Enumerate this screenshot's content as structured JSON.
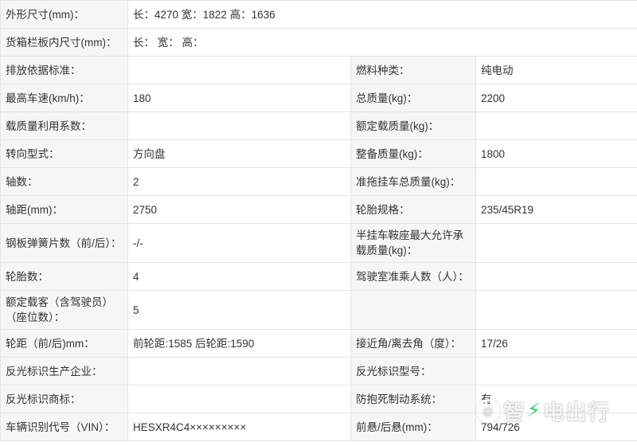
{
  "rows": [
    {
      "type": "wide",
      "label": "外形尺寸(mm)：",
      "value": "长：4270 宽：1822 高：1636"
    },
    {
      "type": "wide",
      "label": "货箱栏板内尺寸(mm)：",
      "value": "长： 宽： 高："
    },
    {
      "type": "pair",
      "label1": "排放依据标准：",
      "value1": "",
      "label2": "燃料种类：",
      "value2": "纯电动"
    },
    {
      "type": "pair",
      "label1": "最高车速(km/h)：",
      "value1": "180",
      "label2": "总质量(kg)：",
      "value2": "2200"
    },
    {
      "type": "pair",
      "label1": "载质量利用系数：",
      "value1": "",
      "label2": "额定载质量(kg)：",
      "value2": ""
    },
    {
      "type": "pair",
      "label1": "转向型式：",
      "value1": "方向盘",
      "label2": "整备质量(kg)：",
      "value2": "1800"
    },
    {
      "type": "pair",
      "label1": "轴数：",
      "value1": "2",
      "label2": "准拖挂车总质量(kg)：",
      "value2": ""
    },
    {
      "type": "pair",
      "label1": "轴距(mm)：",
      "value1": "2750",
      "label2": "轮胎规格：",
      "value2": "235/45R19"
    },
    {
      "type": "pair",
      "label1": "钢板弹簧片数（前/后）：",
      "value1": "-/-",
      "label2": "半挂车鞍座最大允许承载质量(kg)：",
      "value2": ""
    },
    {
      "type": "pair",
      "label1": "轮胎数：",
      "value1": "4",
      "label2": "驾驶室准乘人数（人）：",
      "value2": ""
    },
    {
      "type": "pair",
      "label1": "额定载客（含驾驶员）（座位数）：",
      "value1": "5",
      "label2": "",
      "value2": ""
    },
    {
      "type": "pair",
      "label1": "轮距（前/后)mm：",
      "value1": "前轮距:1585 后轮距:1590",
      "label2": "接近角/离去角（度）：",
      "value2": "17/26"
    },
    {
      "type": "pair",
      "label1": "反光标识生产企业：",
      "value1": "",
      "label2": "反光标识型号：",
      "value2": ""
    },
    {
      "type": "pair",
      "label1": "反光标识商标：",
      "value1": "",
      "label2": "防抱死制动系统：",
      "value2": "有"
    },
    {
      "type": "pair",
      "label1": "车辆识别代号（VIN）：",
      "value1": "HESXR4C4×××××××××",
      "label2": "前悬/后悬(mm)：",
      "value2": "794/726"
    }
  ],
  "watermark": {
    "at": "@",
    "text1": "智",
    "text2": "电出行",
    "bolt_icon": "lightning-bolt-icon",
    "bolt_color": "#35c96b"
  }
}
